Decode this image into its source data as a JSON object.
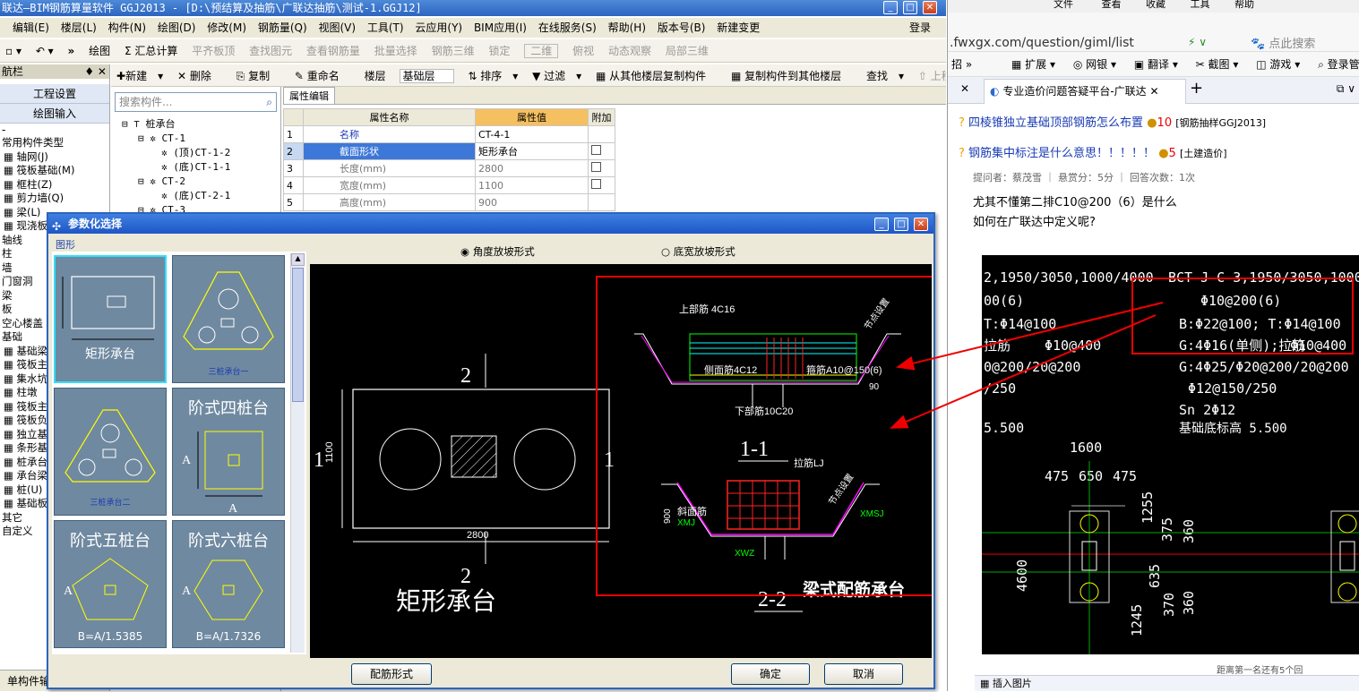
{
  "app": {
    "title": "联达—BIM钢筋算量软件 GGJ2013 - [D:\\预结算及抽筋\\广联达抽筋\\测试-1.GGJ12]"
  },
  "menu": [
    "编辑(E)",
    "楼层(L)",
    "构件(N)",
    "绘图(D)",
    "修改(M)",
    "钢筋量(Q)",
    "视图(V)",
    "工具(T)",
    "云应用(Y)",
    "BIM应用(I)",
    "在线服务(S)",
    "帮助(H)",
    "版本号(B)",
    "新建变更"
  ],
  "menu_right": "登录",
  "toolbar1": [
    "绘图",
    "Σ 汇总计算",
    "平齐板顶",
    "查找图元",
    "查看钢筋量",
    "批量选择",
    "钢筋三维",
    "锁定",
    "二维",
    "俯视",
    "动态观察",
    "局部三维"
  ],
  "toolbar2": [
    "新建",
    "删除",
    "复制",
    "重命名",
    "楼层",
    "基础层",
    "排序",
    "过滤",
    "从其他楼层复制构件",
    "复制构件到其他楼层",
    "查找",
    "上移",
    "下移"
  ],
  "left": {
    "header": "航栏",
    "btn1": "工程设置",
    "btn2": "绘图输入",
    "tree": [
      "常用构件类型",
      "轴网(J)",
      "筏板基础(M)",
      "框柱(Z)",
      "剪力墙(Q)",
      "梁(L)",
      "现浇板",
      "轴线",
      "柱",
      "墙",
      "门窗洞",
      "梁",
      "板",
      "空心楼盖",
      "基础",
      "基础梁",
      "筏板主筋",
      "集水坑",
      "柱墩",
      "筏板主筋",
      "筏板负筋",
      "独立基础",
      "条形基础",
      "桩承台",
      "承台梁",
      "桩(U)",
      "基础板带",
      "其它",
      "自定义"
    ],
    "bottom": "单构件输"
  },
  "mid": {
    "search_placeholder": "搜索构件...",
    "tree": [
      "桩承台",
      "CT-1",
      "(顶)CT-1-2",
      "(底)CT-1-1",
      "CT-2",
      "(底)CT-2-1",
      "CT-3"
    ]
  },
  "props": {
    "tab": "属性编辑",
    "headers": [
      "",
      "属性名称",
      "属性值",
      "附加"
    ],
    "rows": [
      [
        "1",
        "名称",
        "CT-4-1",
        ""
      ],
      [
        "2",
        "截面形状",
        "矩形承台",
        ""
      ],
      [
        "3",
        "长度(mm)",
        "2800",
        ""
      ],
      [
        "4",
        "宽度(mm)",
        "1100",
        ""
      ],
      [
        "5",
        "高度(mm)",
        "900",
        ""
      ]
    ]
  },
  "dialog": {
    "title": "参数化选择",
    "group": "图形",
    "radio1": "角度放坡形式",
    "radio2": "底宽放坡形式",
    "thumbs": [
      "矩形承台",
      "三桩承台一",
      "三桩承台二",
      "阶式四桩台",
      "阶式五桩台",
      "阶式六桩台"
    ],
    "thumb_formula": [
      "B=A/1.5385",
      "B=A/1.7326"
    ],
    "btn_rebar": "配筋形式",
    "btn_ok": "确定",
    "btn_cancel": "取消"
  },
  "drawing": {
    "plan_title": "矩形承台",
    "dim_len": "2800",
    "dim_wid": "1100",
    "mark1": "1",
    "mark2": "2",
    "sec11": "1-1",
    "sec22": "2-2",
    "beam_title": "梁式配筋承台",
    "top": "上部筋 4C16",
    "side": "侧面筋4C12",
    "stirrup": "箍筋A10@150(6)",
    "bottom": "下部筋10C20",
    "tie": "拉筋LJ",
    "slope": "斜面筋",
    "xmj": "XMJ",
    "xmsj": "XMSJ",
    "xwz": "XWZ",
    "node": "节点设置",
    "h900": "900",
    "d90": "90",
    "d100": "100"
  },
  "browser": {
    "menu": [
      "文件",
      "查看",
      "收藏",
      "工具",
      "帮助"
    ],
    "url": ".fwxgx.com/question/giml/list",
    "search": "点此搜索",
    "bar": [
      "扩展",
      "网银",
      "翻译",
      "截图",
      "游戏",
      "登录管"
    ],
    "tab": "专业造价问题答疑平台-广联达",
    "q1": "四棱锥独立基础顶部钢筋怎么布置",
    "q1_score": "10",
    "q1_tag": "[钢筋抽样GGJ2013]",
    "q2": "钢筋集中标注是什么意思！！！！！",
    "q2_score": "5",
    "q2_tag": "[土建造价]",
    "meta": "提问者：蔡茂雪 ｜ 悬赏分：5分 ｜ 回答次数：1次",
    "text1": "尤其不懂第二排C10@200（6）是什么",
    "text2": "如何在广联达中定义呢?",
    "cad": [
      "2,1950/3050,1000/4000",
      "BCT-J-C-3,1950/3050,1000/4000",
      "00(6)",
      "Φ10@200(6)",
      "T:Φ14@100",
      "B:Φ22@100; T:Φ14@100",
      "拉筋",
      "Φ10@400",
      "G:4Φ16(单侧);拉筋",
      "Φ10@400",
      "0@200/20@200",
      "G:4Φ25/Φ20@200/20@200",
      "/250",
      "Φ12@150/250",
      "Sn 2Φ12",
      "5.500",
      "基础底标高 5.500",
      "1600",
      "475",
      "650",
      "475",
      "1255",
      "375",
      "360",
      "4600",
      "635",
      "370",
      "360",
      "1245"
    ],
    "footer": "插入图片",
    "footer2": "距离第一名还有5个回"
  }
}
